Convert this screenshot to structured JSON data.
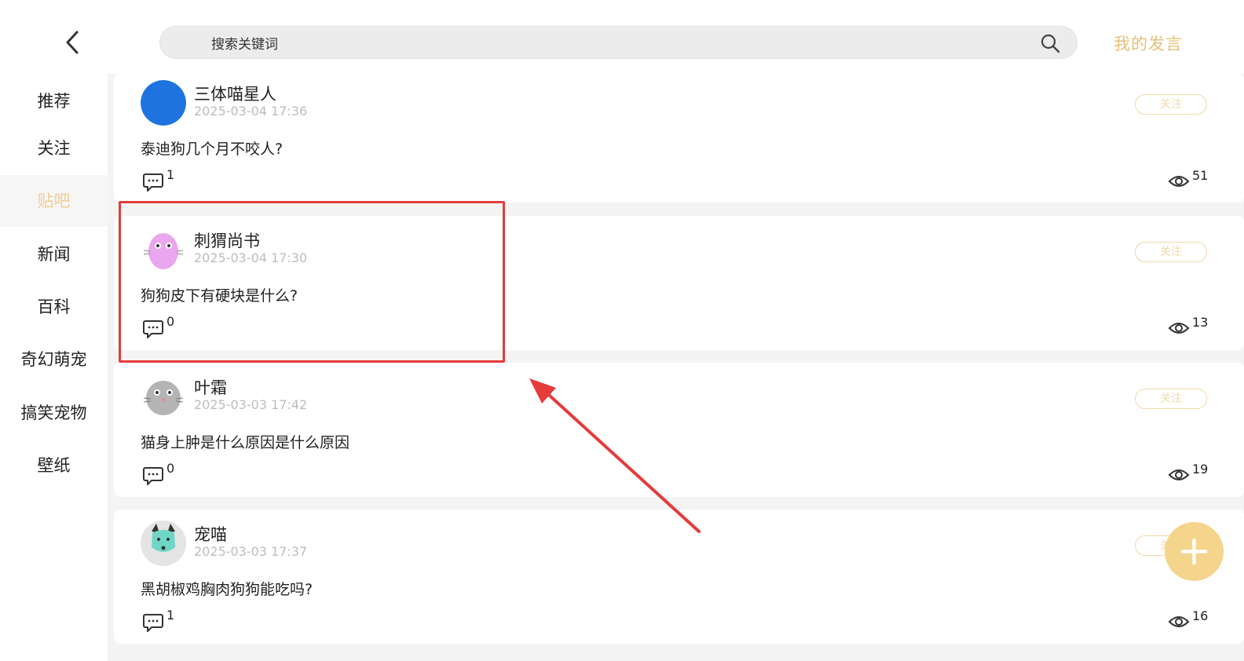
{
  "header": {
    "search_placeholder": "搜索关键词",
    "my_posts_label": "我的发言"
  },
  "sidebar": {
    "items": [
      {
        "label": "推荐",
        "active": false
      },
      {
        "label": "关注",
        "active": false
      },
      {
        "label": "贴吧",
        "active": true
      },
      {
        "label": "新闻",
        "active": false
      },
      {
        "label": "百科",
        "active": false
      },
      {
        "label": "奇幻萌宠",
        "active": false
      },
      {
        "label": "搞笑宠物",
        "active": false
      },
      {
        "label": "壁纸",
        "active": false
      }
    ]
  },
  "posts": [
    {
      "user": "三体喵星人",
      "time": "2025-03-04 17:36",
      "text": "泰迪狗几个月不咬人?",
      "comments": "1",
      "views": "51",
      "follow_label": "关注",
      "avatar": "blue-circle"
    },
    {
      "user": "刺猬尚书",
      "time": "2025-03-04 17:30",
      "text": "狗狗皮下有硬块是什么?",
      "comments": "0",
      "views": "13",
      "follow_label": "关注",
      "avatar": "pink-cartoon"
    },
    {
      "user": "叶霜",
      "time": "2025-03-03 17:42",
      "text": "猫身上肿是什么原因是什么原因",
      "comments": "0",
      "views": "19",
      "follow_label": "关注",
      "avatar": "grey-cartoon"
    },
    {
      "user": "宠喵",
      "time": "2025-03-03 17:37",
      "text": "黑胡椒鸡胸肉狗狗能吃吗?",
      "comments": "1",
      "views": "16",
      "follow_label": "关注",
      "avatar": "husky-cartoon"
    }
  ],
  "colors": {
    "accent": "#e6c07a",
    "follow": "#f1d9a7",
    "fab": "#f4d58b",
    "annotation": "#e53b3b"
  },
  "icons": {
    "back": "chevron-left-icon",
    "search": "search-icon",
    "comment": "comment-icon",
    "views": "eye-icon",
    "fab": "plus-icon"
  }
}
